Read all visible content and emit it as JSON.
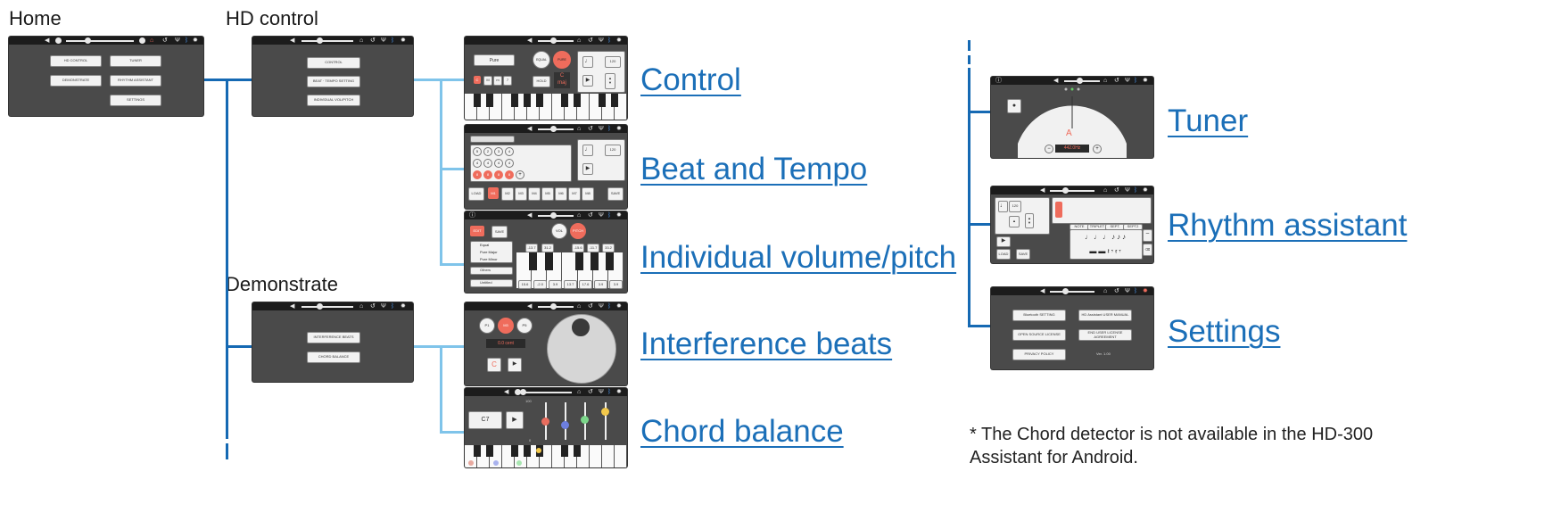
{
  "titles": {
    "home": "Home",
    "hd_control": "HD control",
    "demonstrate": "Demonstrate"
  },
  "home_screen": {
    "hd_control": "HD CONTROL",
    "tuner": "TUNER",
    "demonstrate": "DEMONSTRATE",
    "rhythm_assistant": "RHYTHM ASSISTANT",
    "settings": "SETTINGS"
  },
  "hd_control_screen": {
    "control": "CONTROL",
    "beat_tempo": "BEAT · TEMPO SETTING",
    "individual": "INDIVIDUAL VOL/PITCH"
  },
  "demonstrate_screen": {
    "interference": "INTERFERENCE BEATS",
    "chord_balance": "CHORD BALANCE"
  },
  "links": {
    "control": "Control",
    "beat_tempo": "Beat and Tempo",
    "individual": "Individual volume/pitch",
    "interference": "Interference beats",
    "chord_balance": "Chord balance",
    "tuner": "Tuner",
    "rhythm_assistant": "Rhythm assistant",
    "settings": "Settings"
  },
  "control_screen": {
    "pure": "Pure",
    "equal": "EQUAL",
    "pure_btn": "PURE",
    "hold": "HOLD",
    "key": "C",
    "scale": "maj",
    "tempo": "120",
    "notes": [
      "C",
      "M",
      "m",
      "7"
    ]
  },
  "beat_screen": {
    "load": "LOAD",
    "save": "SAVE",
    "tempo": "120",
    "memories": [
      "M1",
      "M2",
      "M3",
      "M4",
      "M5",
      "M6",
      "M7",
      "M8"
    ],
    "beats": [
      "5",
      "2",
      "3",
      "4",
      "4",
      "4",
      "4",
      "4",
      "8",
      "8",
      "8",
      "8"
    ]
  },
  "individual_screen": {
    "edit": "EDIT",
    "save": "SAVE",
    "vol": "VOL",
    "pitch": "PITCH",
    "options": [
      "Equal",
      "Pure Major",
      "Pure Minor"
    ],
    "others": "Others",
    "untitled": "Untitled",
    "upper_values": [
      "-13.7",
      "31.2",
      "-15.6",
      "-11.7",
      "33.2"
    ],
    "lower_values": [
      "15.6",
      "-2.0",
      "3.9",
      "13.7",
      "17.6",
      "3.9",
      "3.9"
    ]
  },
  "interference_screen": {
    "p1": "P1",
    "m3": "M3",
    "p5": "P5",
    "cent": "0.0 cent",
    "key": "C"
  },
  "chord_screen": {
    "chord": "C7",
    "scale_top": "100",
    "scale_bottom": "0"
  },
  "tuner_screen": {
    "note": "A",
    "freq": "442.0Hz"
  },
  "rhythm_screen": {
    "tempo": "120",
    "tabs": [
      "NOTE",
      "TRIPLET",
      "SEPT.",
      "SEPT2"
    ],
    "load": "LOAD",
    "save": "SAVE"
  },
  "settings_screen": {
    "bluetooth": "Bluetooth SETTING",
    "manual": "HD Assistant USER MANUAL",
    "oss": "OPEN SOURCE LICENSE",
    "eula": "END USER LICENSE AGREEMENT",
    "privacy": "PRIVACY POLICY",
    "version": "Ver. 1.00"
  },
  "note": "* The Chord detector is not available in the HD-300 Assistant for Android.",
  "colors": {
    "dark_line": "#1569b3",
    "light_line": "#7fc4ea",
    "accent": "#ef6c5c",
    "link": "#1b6fb8"
  }
}
